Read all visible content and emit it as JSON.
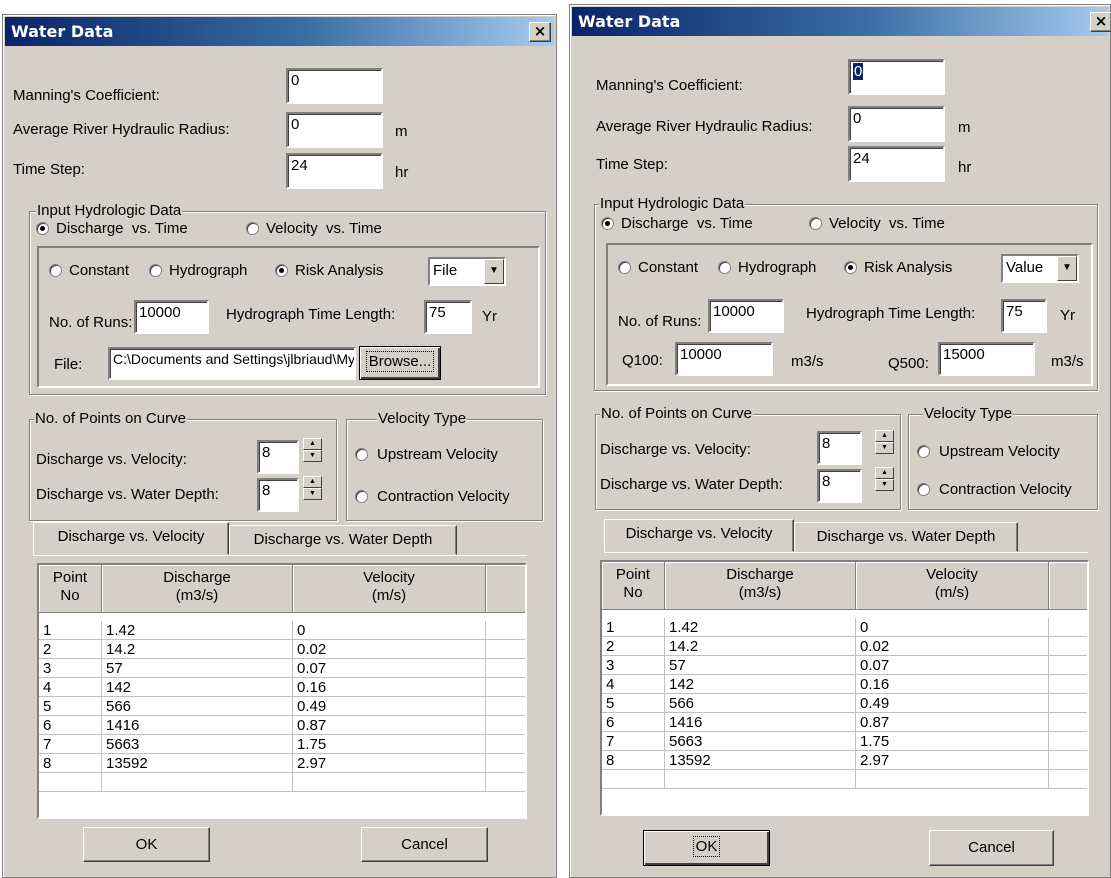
{
  "dialog_left": {
    "title": "Water Data",
    "close_label": "×",
    "manning_label": "Manning's Coefficient:",
    "manning_value": "0",
    "radius_label": "Average River Hydraulic Radius:",
    "radius_value": "0",
    "radius_unit": "m",
    "timestep_label": "Time Step:",
    "timestep_value": "24",
    "timestep_unit": "hr",
    "input_group_title": "Input Hydrologic Data",
    "discharge_time_label": "Discharge  vs. Time",
    "discharge_time_selected": true,
    "velocity_time_label": "Velocity  vs. Time",
    "velocity_time_selected": false,
    "constant_label": "Constant",
    "hydrograph_label": "Hydrograph",
    "risk_label": "Risk Analysis",
    "risk_selected": true,
    "source_select_value": "File",
    "runs_label": "No. of Runs:",
    "runs_value": "10000",
    "hydro_length_label": "Hydrograph Time Length:",
    "hydro_length_value": "75",
    "hydro_length_unit": "Yr",
    "file_label": "File:",
    "file_value": "C:\\Documents and Settings\\jlbriaud\\My",
    "browse_label": "Browse...",
    "points_group_title": "No. of Points on Curve",
    "dv_points_label": "Discharge vs. Velocity:",
    "dv_points_value": "8",
    "dd_points_label": "Discharge vs. Water Depth:",
    "dd_points_value": "8",
    "vtype_group_title": "Velocity Type",
    "upstream_label": "Upstream Velocity",
    "contraction_label": "Contraction Velocity",
    "tab_dv": "Discharge vs. Velocity",
    "tab_dd": "Discharge vs. Water Depth",
    "col_point": "Point\nNo",
    "col_discharge": "Discharge\n(m3/s)",
    "col_velocity": "Velocity\n(m/s)",
    "rows": [
      {
        "point": "1",
        "discharge": "1.42",
        "velocity": "0"
      },
      {
        "point": "2",
        "discharge": "14.2",
        "velocity": "0.02"
      },
      {
        "point": "3",
        "discharge": "57",
        "velocity": "0.07"
      },
      {
        "point": "4",
        "discharge": "142",
        "velocity": "0.16"
      },
      {
        "point": "5",
        "discharge": "566",
        "velocity": "0.49"
      },
      {
        "point": "6",
        "discharge": "1416",
        "velocity": "0.87"
      },
      {
        "point": "7",
        "discharge": "5663",
        "velocity": "1.75"
      },
      {
        "point": "8",
        "discharge": "13592",
        "velocity": "2.97"
      }
    ],
    "ok_label": "OK",
    "cancel_label": "Cancel"
  },
  "dialog_right": {
    "title": "Water Data",
    "close_label": "×",
    "manning_label": "Manning's Coefficient:",
    "manning_value": "0",
    "radius_label": "Average River Hydraulic Radius:",
    "radius_value": "0",
    "radius_unit": "m",
    "timestep_label": "Time Step:",
    "timestep_value": "24",
    "timestep_unit": "hr",
    "input_group_title": "Input Hydrologic Data",
    "discharge_time_label": "Discharge  vs. Time",
    "velocity_time_label": "Velocity  vs. Time",
    "constant_label": "Constant",
    "hydrograph_label": "Hydrograph",
    "risk_label": "Risk Analysis",
    "source_select_value": "Value",
    "runs_label": "No. of Runs:",
    "runs_value": "10000",
    "hydro_length_label": "Hydrograph Time Length:",
    "hydro_length_value": "75",
    "hydro_length_unit": "Yr",
    "q100_label": "Q100:",
    "q100_value": "10000",
    "q100_unit": "m3/s",
    "q500_label": "Q500:",
    "q500_value": "15000",
    "q500_unit": "m3/s",
    "points_group_title": "No. of Points on Curve",
    "dv_points_label": "Discharge vs. Velocity:",
    "dv_points_value": "8",
    "dd_points_label": "Discharge vs. Water Depth:",
    "dd_points_value": "8",
    "vtype_group_title": "Velocity Type",
    "upstream_label": "Upstream Velocity",
    "contraction_label": "Contraction Velocity",
    "tab_dv": "Discharge vs. Velocity",
    "tab_dd": "Discharge vs. Water Depth",
    "col_point": "Point\nNo",
    "col_discharge": "Discharge\n(m3/s)",
    "col_velocity": "Velocity\n(m/s)",
    "rows": [
      {
        "point": "1",
        "discharge": "1.42",
        "velocity": "0"
      },
      {
        "point": "2",
        "discharge": "14.2",
        "velocity": "0.02"
      },
      {
        "point": "3",
        "discharge": "57",
        "velocity": "0.07"
      },
      {
        "point": "4",
        "discharge": "142",
        "velocity": "0.16"
      },
      {
        "point": "5",
        "discharge": "566",
        "velocity": "0.49"
      },
      {
        "point": "6",
        "discharge": "1416",
        "velocity": "0.87"
      },
      {
        "point": "7",
        "discharge": "5663",
        "velocity": "1.75"
      },
      {
        "point": "8",
        "discharge": "13592",
        "velocity": "2.97"
      }
    ],
    "ok_label": "OK",
    "cancel_label": "Cancel"
  }
}
